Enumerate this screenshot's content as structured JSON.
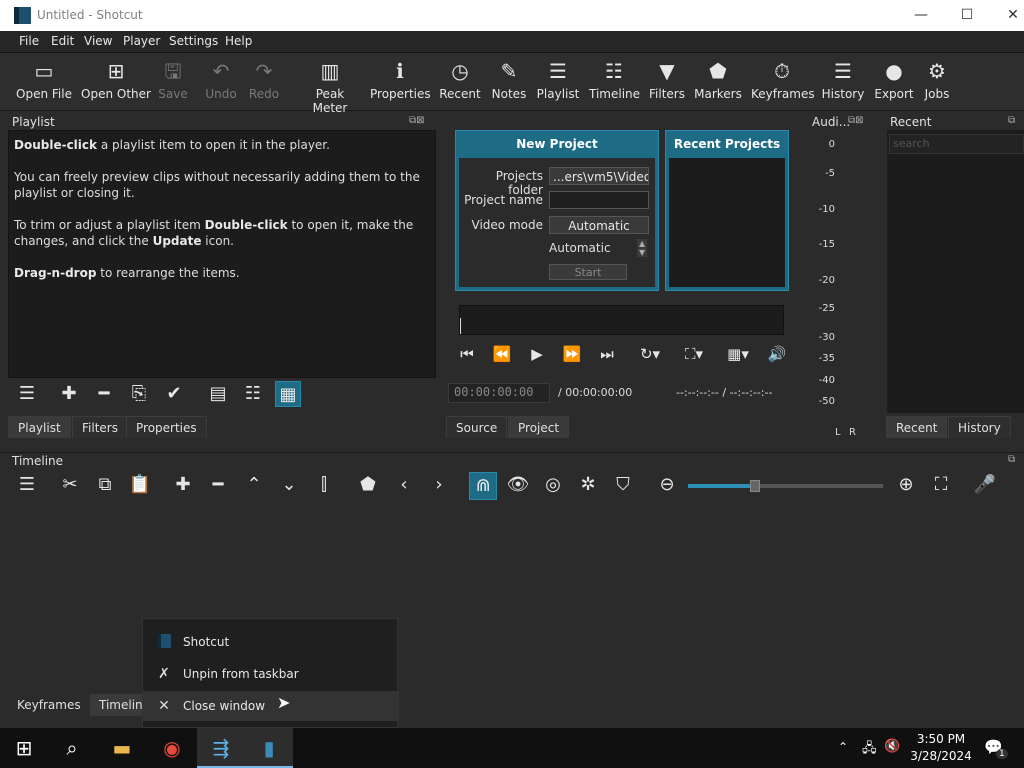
{
  "window": {
    "title": "Untitled - Shotcut",
    "minimize": "—",
    "maximize": "☐",
    "close": "✕"
  },
  "menu": [
    "File",
    "Edit",
    "View",
    "Player",
    "Settings",
    "Help"
  ],
  "toolbar": [
    {
      "label": "Open File",
      "icon": "▭"
    },
    {
      "label": "Open Other",
      "icon": "⊞"
    },
    {
      "label": "Save",
      "icon": "🖫"
    },
    {
      "label": "Undo",
      "icon": "↶"
    },
    {
      "label": "Redo",
      "icon": "↷"
    },
    {
      "label": "Peak Meter",
      "icon": "▥"
    },
    {
      "label": "Properties",
      "icon": "ℹ"
    },
    {
      "label": "Recent",
      "icon": "◷"
    },
    {
      "label": "Notes",
      "icon": "✎"
    },
    {
      "label": "Playlist",
      "icon": "☰"
    },
    {
      "label": "Timeline",
      "icon": "☷"
    },
    {
      "label": "Filters",
      "icon": "▼"
    },
    {
      "label": "Markers",
      "icon": "⬟"
    },
    {
      "label": "Keyframes",
      "icon": "⏱"
    },
    {
      "label": "History",
      "icon": "☰"
    },
    {
      "label": "Export",
      "icon": "●"
    },
    {
      "label": "Jobs",
      "icon": "⚙"
    }
  ],
  "playlist": {
    "title": "Playlist",
    "p1_b": "Double-click",
    "p1": " a playlist item to open it in the player.",
    "p2": "You can freely preview clips without necessarily adding them to the playlist or closing it.",
    "p3_a": "To trim or adjust a playlist item ",
    "p3_b": "Double-click",
    "p3_c": " to open it, make the changes, and click the ",
    "p3_d": "Update",
    "p3_e": " icon.",
    "p4_b": "Drag-n-drop",
    "p4": " to rearrange the items.",
    "tabs": [
      "Playlist",
      "Filters",
      "Properties"
    ]
  },
  "new_project": {
    "title": "New Project",
    "folder_label": "Projects folder",
    "folder_value": "...ers\\vm5\\Videos",
    "name_label": "Project name",
    "name_value": "",
    "mode_label": "Video mode",
    "mode_value": "Automatic",
    "mode_sub": "Automatic",
    "start": "Start"
  },
  "recent_projects": {
    "title": "Recent Projects"
  },
  "player": {
    "timecode": "00:00:00:00",
    "duration": "/ 00:00:00:00",
    "in_out": "--:--:--:-- /  --:--:--:--",
    "tabs": [
      "Source",
      "Project"
    ]
  },
  "audio": {
    "title": "Audi...",
    "scale": [
      "0",
      "-5",
      "-10",
      "-15",
      "-20",
      "-25",
      "-30",
      "-35",
      "-40",
      "-50"
    ],
    "l": "L",
    "r": "R"
  },
  "recent": {
    "title": "Recent",
    "search_placeholder": "search",
    "tabs": [
      "Recent",
      "History"
    ]
  },
  "timeline": {
    "title": "Timeline",
    "tabs": [
      "Keyframes",
      "Timeline"
    ]
  },
  "context_menu": {
    "items": [
      "Shotcut",
      "Unpin from taskbar",
      "Close window"
    ]
  },
  "clock": {
    "time": "3:50 PM",
    "date": "3/28/2024"
  },
  "notification_count": "1"
}
